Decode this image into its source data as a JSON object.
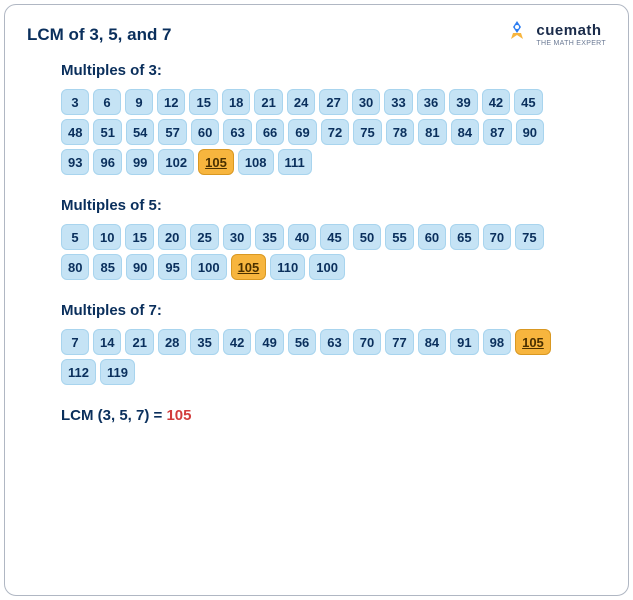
{
  "title": "LCM of 3, 5, and 7",
  "brand": {
    "name": "cuemath",
    "tagline": "THE MATH EXPERT"
  },
  "sections": [
    {
      "label": "Multiples of 3:",
      "items": [
        {
          "v": "3"
        },
        {
          "v": "6"
        },
        {
          "v": "9"
        },
        {
          "v": "12"
        },
        {
          "v": "15"
        },
        {
          "v": "18"
        },
        {
          "v": "21"
        },
        {
          "v": "24"
        },
        {
          "v": "27"
        },
        {
          "v": "30"
        },
        {
          "v": "33"
        },
        {
          "v": "36"
        },
        {
          "v": "39"
        },
        {
          "v": "42"
        },
        {
          "v": "45"
        },
        {
          "v": "48"
        },
        {
          "v": "51"
        },
        {
          "v": "54"
        },
        {
          "v": "57"
        },
        {
          "v": "60"
        },
        {
          "v": "63"
        },
        {
          "v": "66"
        },
        {
          "v": "69"
        },
        {
          "v": "72"
        },
        {
          "v": "75"
        },
        {
          "v": "78"
        },
        {
          "v": "81"
        },
        {
          "v": "84"
        },
        {
          "v": "87"
        },
        {
          "v": "90"
        },
        {
          "v": "93"
        },
        {
          "v": "96"
        },
        {
          "v": "99"
        },
        {
          "v": "102"
        },
        {
          "v": "105",
          "hl": true
        },
        {
          "v": "108"
        },
        {
          "v": "111"
        }
      ]
    },
    {
      "label": "Multiples of 5:",
      "items": [
        {
          "v": "5"
        },
        {
          "v": "10"
        },
        {
          "v": "15"
        },
        {
          "v": "20"
        },
        {
          "v": "25"
        },
        {
          "v": "30"
        },
        {
          "v": "35"
        },
        {
          "v": "40"
        },
        {
          "v": "45"
        },
        {
          "v": "50"
        },
        {
          "v": "55"
        },
        {
          "v": "60"
        },
        {
          "v": "65"
        },
        {
          "v": "70"
        },
        {
          "v": "75"
        },
        {
          "v": "80"
        },
        {
          "v": "85"
        },
        {
          "v": "90"
        },
        {
          "v": "95"
        },
        {
          "v": "100"
        },
        {
          "v": "105",
          "hl": true
        },
        {
          "v": "110"
        },
        {
          "v": "100"
        }
      ]
    },
    {
      "label": "Multiples of 7:",
      "items": [
        {
          "v": "7"
        },
        {
          "v": "14"
        },
        {
          "v": "21"
        },
        {
          "v": "28"
        },
        {
          "v": "35"
        },
        {
          "v": "42"
        },
        {
          "v": "49"
        },
        {
          "v": "56"
        },
        {
          "v": "63"
        },
        {
          "v": "70"
        },
        {
          "v": "77"
        },
        {
          "v": "84"
        },
        {
          "v": "91"
        },
        {
          "v": "98"
        },
        {
          "v": "105",
          "hl": true
        },
        {
          "v": "112"
        },
        {
          "v": "119"
        }
      ]
    }
  ],
  "result": {
    "label": "LCM (3, 5, 7) = ",
    "value": "105"
  },
  "chart_data": {
    "type": "table",
    "title": "LCM of 3, 5 and 7 via listing multiples",
    "series": [
      {
        "name": "Multiples of 3",
        "values": [
          3,
          6,
          9,
          12,
          15,
          18,
          21,
          24,
          27,
          30,
          33,
          36,
          39,
          42,
          45,
          48,
          51,
          54,
          57,
          60,
          63,
          66,
          69,
          72,
          75,
          78,
          81,
          84,
          87,
          90,
          93,
          96,
          99,
          102,
          105,
          108,
          111
        ]
      },
      {
        "name": "Multiples of 5",
        "values": [
          5,
          10,
          15,
          20,
          25,
          30,
          35,
          40,
          45,
          50,
          55,
          60,
          65,
          70,
          75,
          80,
          85,
          90,
          95,
          100,
          105,
          110,
          100
        ]
      },
      {
        "name": "Multiples of 7",
        "values": [
          7,
          14,
          21,
          28,
          35,
          42,
          49,
          56,
          63,
          70,
          77,
          84,
          91,
          98,
          105,
          112,
          119
        ]
      }
    ],
    "highlight": 105,
    "lcm": 105
  }
}
